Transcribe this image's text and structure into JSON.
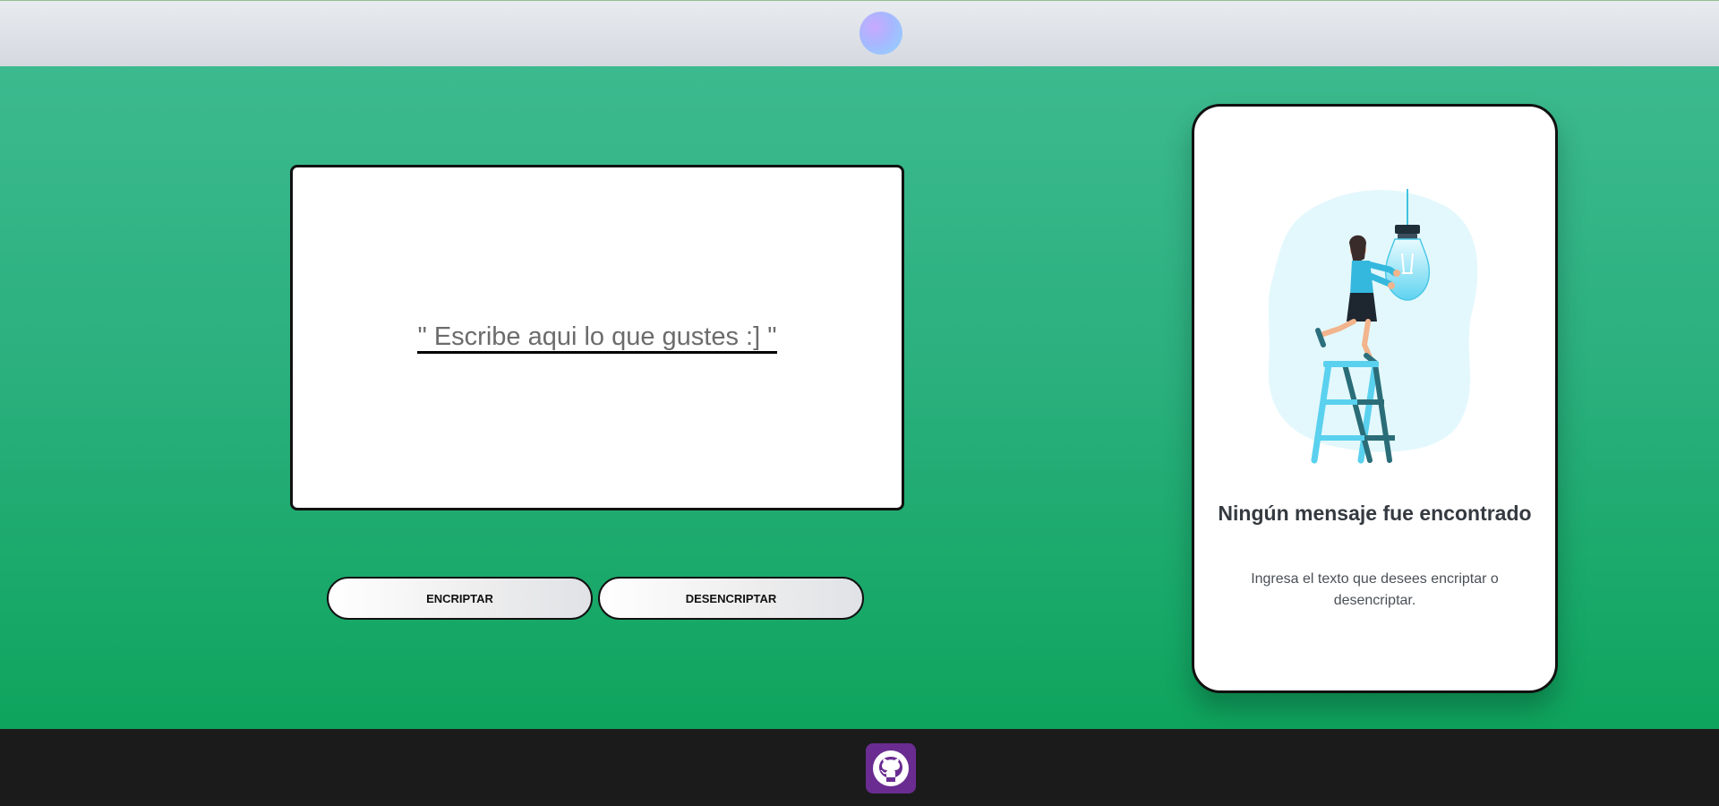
{
  "header": {
    "logo_icon": "gradient-orb-logo-icon"
  },
  "input": {
    "placeholder": "\" Escribe aqui lo que gustes :] \""
  },
  "actions": {
    "encrypt_label": "ENCRIPTAR",
    "decrypt_label": "DESENCRIPTAR"
  },
  "result": {
    "illustration_icon": "woman-ladder-lightbulb-illustration",
    "title": "Ningún mensaje fue encontrado",
    "text": "Ingresa el texto que desees encriptar o desencriptar."
  },
  "footer": {
    "github_icon": "github-icon"
  },
  "colors": {
    "background_top": "#3cba8f",
    "background_bottom": "#0ea45d",
    "footer": "#1b1b1c",
    "github_badge": "#6a2c91"
  }
}
